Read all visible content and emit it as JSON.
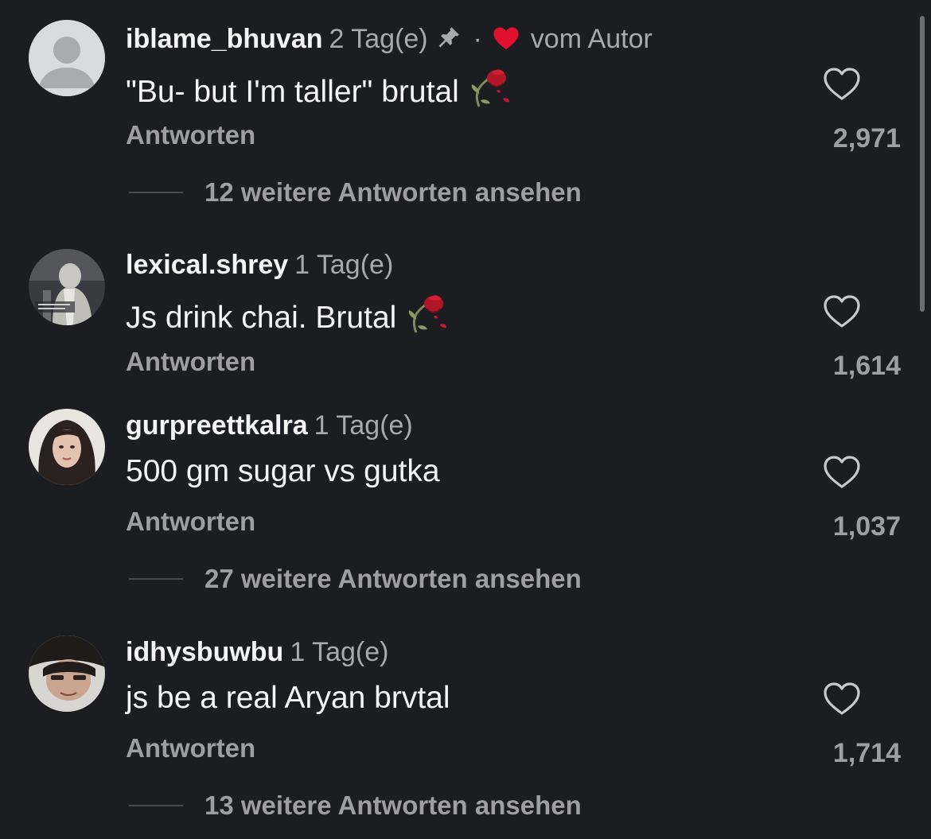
{
  "colors": {
    "background": "#1c1d20",
    "text_primary": "#f5f5f5",
    "text_secondary": "#a8a8ad",
    "heart_red": "#e0102e"
  },
  "labels": {
    "reply": "Antworten"
  },
  "comments": [
    {
      "username": "iblame_bhuvan",
      "timestamp": "2 Tag(e)",
      "pinned": true,
      "author_like_label": "vom Autor",
      "text": "\"Bu- but I'm taller\" brutal",
      "emoji": "wilted-rose",
      "like_count": "2,971",
      "view_replies": "12 weitere Antworten ansehen"
    },
    {
      "username": "lexical.shrey",
      "timestamp": "1 Tag(e)",
      "text": "Js drink chai. Brutal",
      "emoji": "wilted-rose",
      "like_count": "1,614"
    },
    {
      "username": "gurpreettkalra",
      "timestamp": "1 Tag(e)",
      "text": "500 gm sugar vs gutka",
      "like_count": "1,037",
      "view_replies": "27 weitere Antworten ansehen"
    },
    {
      "username": "idhysbuwbu",
      "timestamp": "1 Tag(e)",
      "text": "js be a real Aryan brvtal",
      "like_count": "1,714",
      "view_replies": "13 weitere Antworten ansehen"
    }
  ]
}
